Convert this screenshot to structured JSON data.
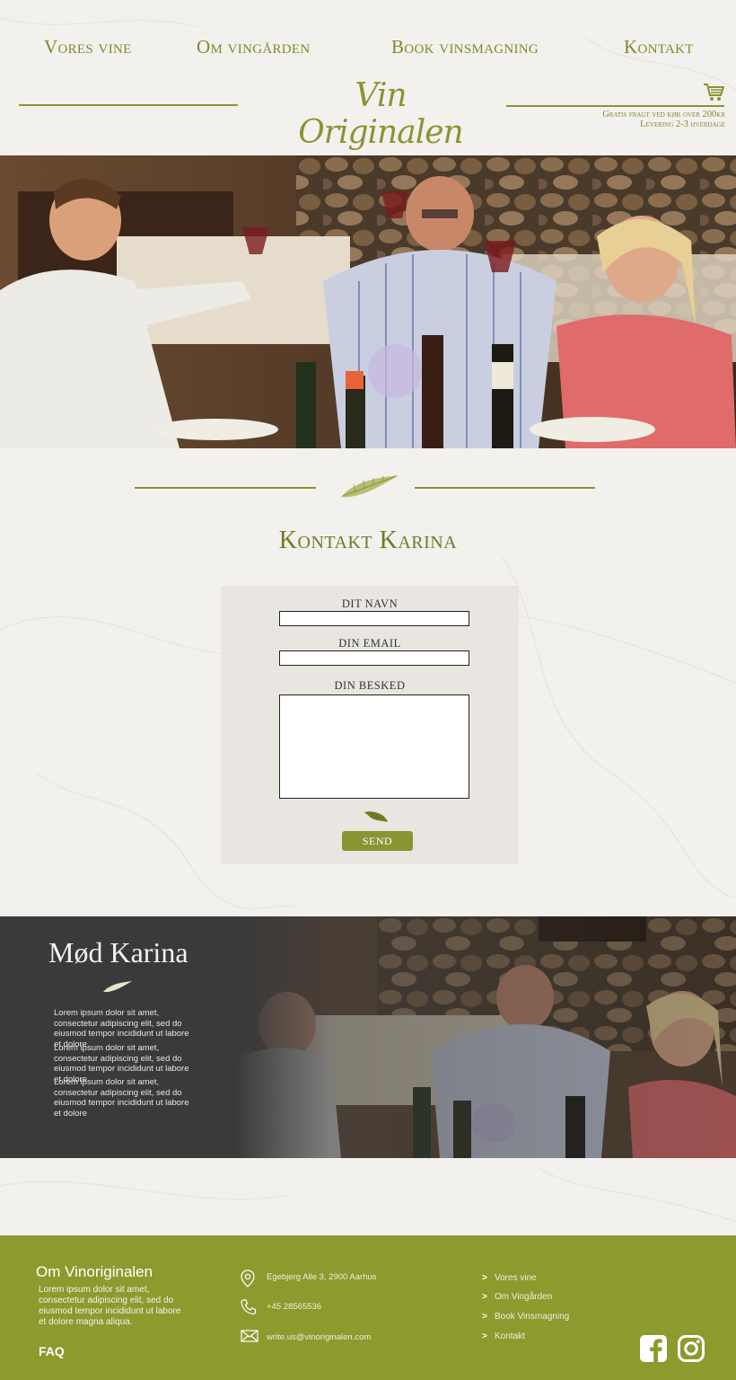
{
  "nav": {
    "items": [
      "Vores vine",
      "Om vingården",
      "Book vinsmagning",
      "Kontakt"
    ]
  },
  "brand": {
    "logo": "Vin Originalen",
    "shipping_line1": "Gratis fragt ved køb over 200kr",
    "shipping_line2": "Levering 2-3 hverdage"
  },
  "contact": {
    "title": "Kontakt Karina",
    "name_label": "DIT NAVN",
    "email_label": "DIN EMAIL",
    "message_label": "DIN BESKED",
    "name_value": "",
    "email_value": "",
    "message_value": "",
    "send_label": "SEND"
  },
  "meet": {
    "title": "Mød Karina",
    "paragraphs": [
      "Lorem ipsum dolor sit amet, consectetur adipiscing elit, sed do eiusmod tempor incididunt ut labore et dolore",
      "Lorem ipsum dolor sit amet, consectetur adipiscing elit, sed do eiusmod tempor incididunt ut labore et dolore",
      "Lorem ipsum dolor sit amet, consectetur adipiscing elit, sed do eiusmod tempor incididunt ut labore et dolore"
    ]
  },
  "footer": {
    "about_title": "Om Vinoriginalen",
    "about_text": "Lorem ipsum dolor sit amet, consectetur adipiscing elit, sed do eiusmod tempor incididunt ut labore et dolore magna aliqua.",
    "faq": "FAQ",
    "address": "Egebjerg Alle 3, 2900 Aarhus",
    "phone": "+45 28565536",
    "email": "write.us@vinoriginalen.com",
    "links": [
      "Vores vine",
      "Om Vingården",
      "Book Vinsmagning",
      "Kontakt"
    ],
    "link_arrow": ">"
  },
  "icons": {
    "cart": "shopping-cart-icon",
    "leaf": "feather-leaf-icon",
    "location": "map-pin-icon",
    "phone": "phone-icon",
    "mail": "envelope-icon",
    "facebook": "facebook-icon",
    "instagram": "instagram-icon"
  },
  "colors": {
    "olive": "#8a9432",
    "dark_olive": "#6f7a22",
    "footer_bg": "#8c9a2e",
    "meet_bg": "#3a3a3a",
    "form_bg": "#e9e6e1"
  }
}
